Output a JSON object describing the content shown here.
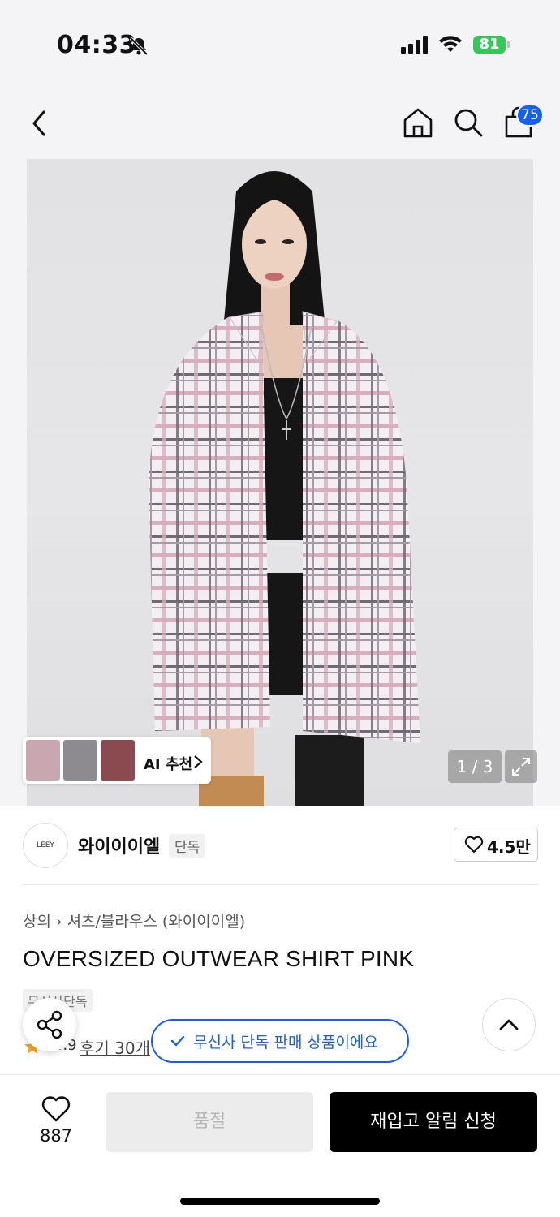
{
  "status_bar": {
    "time": "04:33",
    "battery": "81"
  },
  "nav": {
    "cart_count": "75",
    "icons": [
      "back-icon",
      "home-icon",
      "search-icon",
      "cart-icon"
    ]
  },
  "gallery": {
    "counter": "1 / 3",
    "ai_label": "AI 추천"
  },
  "brand": {
    "logo_text": "LEEY",
    "name": "와이이이엘",
    "tag": "단독",
    "likes": "4.5만"
  },
  "breadcrumb": {
    "category": "상의",
    "subcategory": "셔츠/블라우스 (와이이이엘)"
  },
  "product": {
    "title": "OVERSIZED OUTWEAR SHIRT PINK",
    "exclusive_tag": "무신사단독",
    "rating": "4.9",
    "reviews": "후기 30개"
  },
  "toast": {
    "text": "무신사 단독 판매 상품이에요"
  },
  "bottom_bar": {
    "fav_count": "887",
    "soldout_label": "품절",
    "restock_label": "재입고 알림 신청"
  },
  "colors": {
    "accent_blue": "#1a5ee8",
    "badge_blue": "#1460f0",
    "battery_green": "#34c759"
  }
}
